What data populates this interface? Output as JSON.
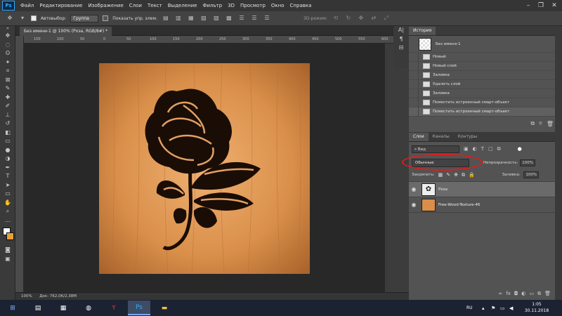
{
  "menu": {
    "logo": "Ps",
    "items": [
      "Файл",
      "Редактирование",
      "Изображение",
      "Слои",
      "Текст",
      "Выделение",
      "Фильтр",
      "3D",
      "Просмотр",
      "Окно",
      "Справка"
    ]
  },
  "options": {
    "autoselect_label": "Автовыбор:",
    "autoselect_value": "Группа",
    "show_transform_label": "Показать упр. элем.",
    "mode_3d_label": "3D-режим:"
  },
  "document": {
    "tab_title": "Без имени-1 @ 100% (Роза, RGB/8#) *",
    "ruler_ticks": [
      "150",
      "100",
      "50",
      "0",
      "50",
      "100",
      "150",
      "200",
      "250",
      "300",
      "350",
      "400",
      "450",
      "500",
      "550",
      "600"
    ],
    "zoom": "100%",
    "doc_size": "Док: 762,0K/2,38M"
  },
  "history": {
    "tab": "История",
    "snapshot": "Без имени-1",
    "items": [
      "Новый",
      "Новый слой",
      "Заливка",
      "Удалить слой",
      "Заливка",
      "Поместить встроенный смарт-объект",
      "Поместить встроенный смарт-объект"
    ]
  },
  "layers": {
    "tabs": [
      "Слои",
      "Каналы",
      "Контуры"
    ],
    "filter_kind": "Вид",
    "blend_mode": "Обычные",
    "opacity_label": "Непрозрачность:",
    "opacity_value": "100%",
    "lock_label": "Закрепить:",
    "fill_label": "Заливка:",
    "fill_value": "100%",
    "items": [
      {
        "name": "Роза",
        "selected": true
      },
      {
        "name": "Free-Wood-Texture-46",
        "selected": false
      }
    ]
  },
  "taskbar": {
    "lang": "RU",
    "time": "1:05",
    "date": "30.11.2018"
  },
  "colors": {
    "accent_red": "#e01b1b",
    "ps_blue": "#31a8ff",
    "wood": "#d98f4a"
  }
}
